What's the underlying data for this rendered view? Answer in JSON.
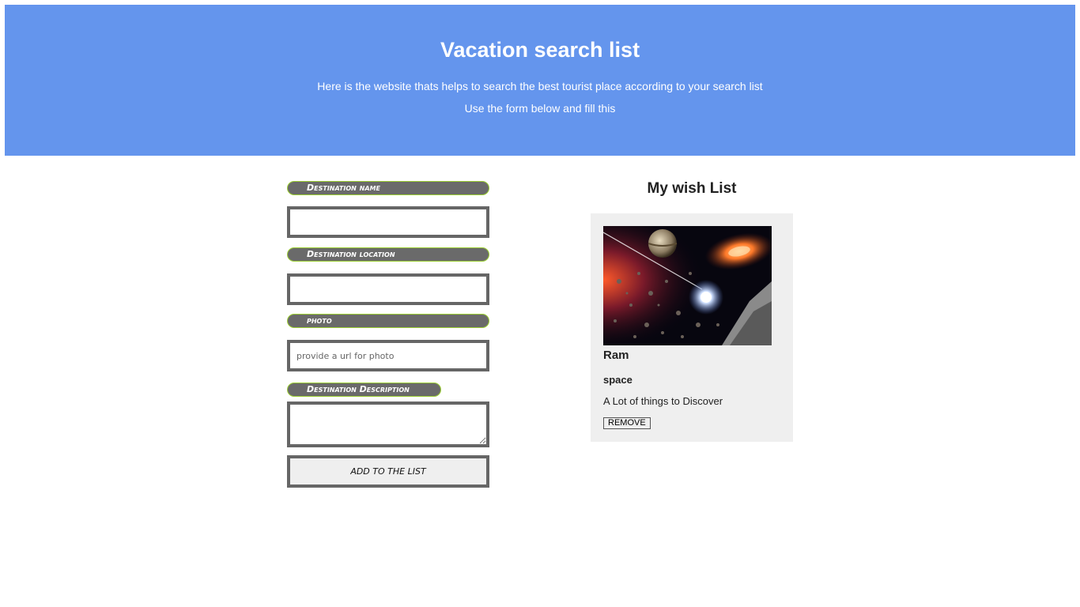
{
  "header": {
    "title": "Vacation search list",
    "subtitle": "Here is the website thats helps to search the best tourist place according to your search list",
    "instruction": "Use the form below and fill this",
    "background_color": "#6495ed"
  },
  "form": {
    "name_label": "Destination name",
    "name_value": "",
    "location_label": "Destination location",
    "location_value": "",
    "photo_label": "photo",
    "photo_placeholder": "provide a url for photo",
    "description_label": "Destination Description",
    "description_value": "",
    "submit_label": "Add to the list",
    "label_color": "#6a6a6a",
    "label_border_color": "#9acd32"
  },
  "wishlist": {
    "title": "My wish List",
    "cards": [
      {
        "name": "Ram",
        "location": "space",
        "description": "A Lot of things to Discover",
        "remove_label": "REMOVE",
        "photo_icon": "space-scene-image"
      }
    ]
  }
}
